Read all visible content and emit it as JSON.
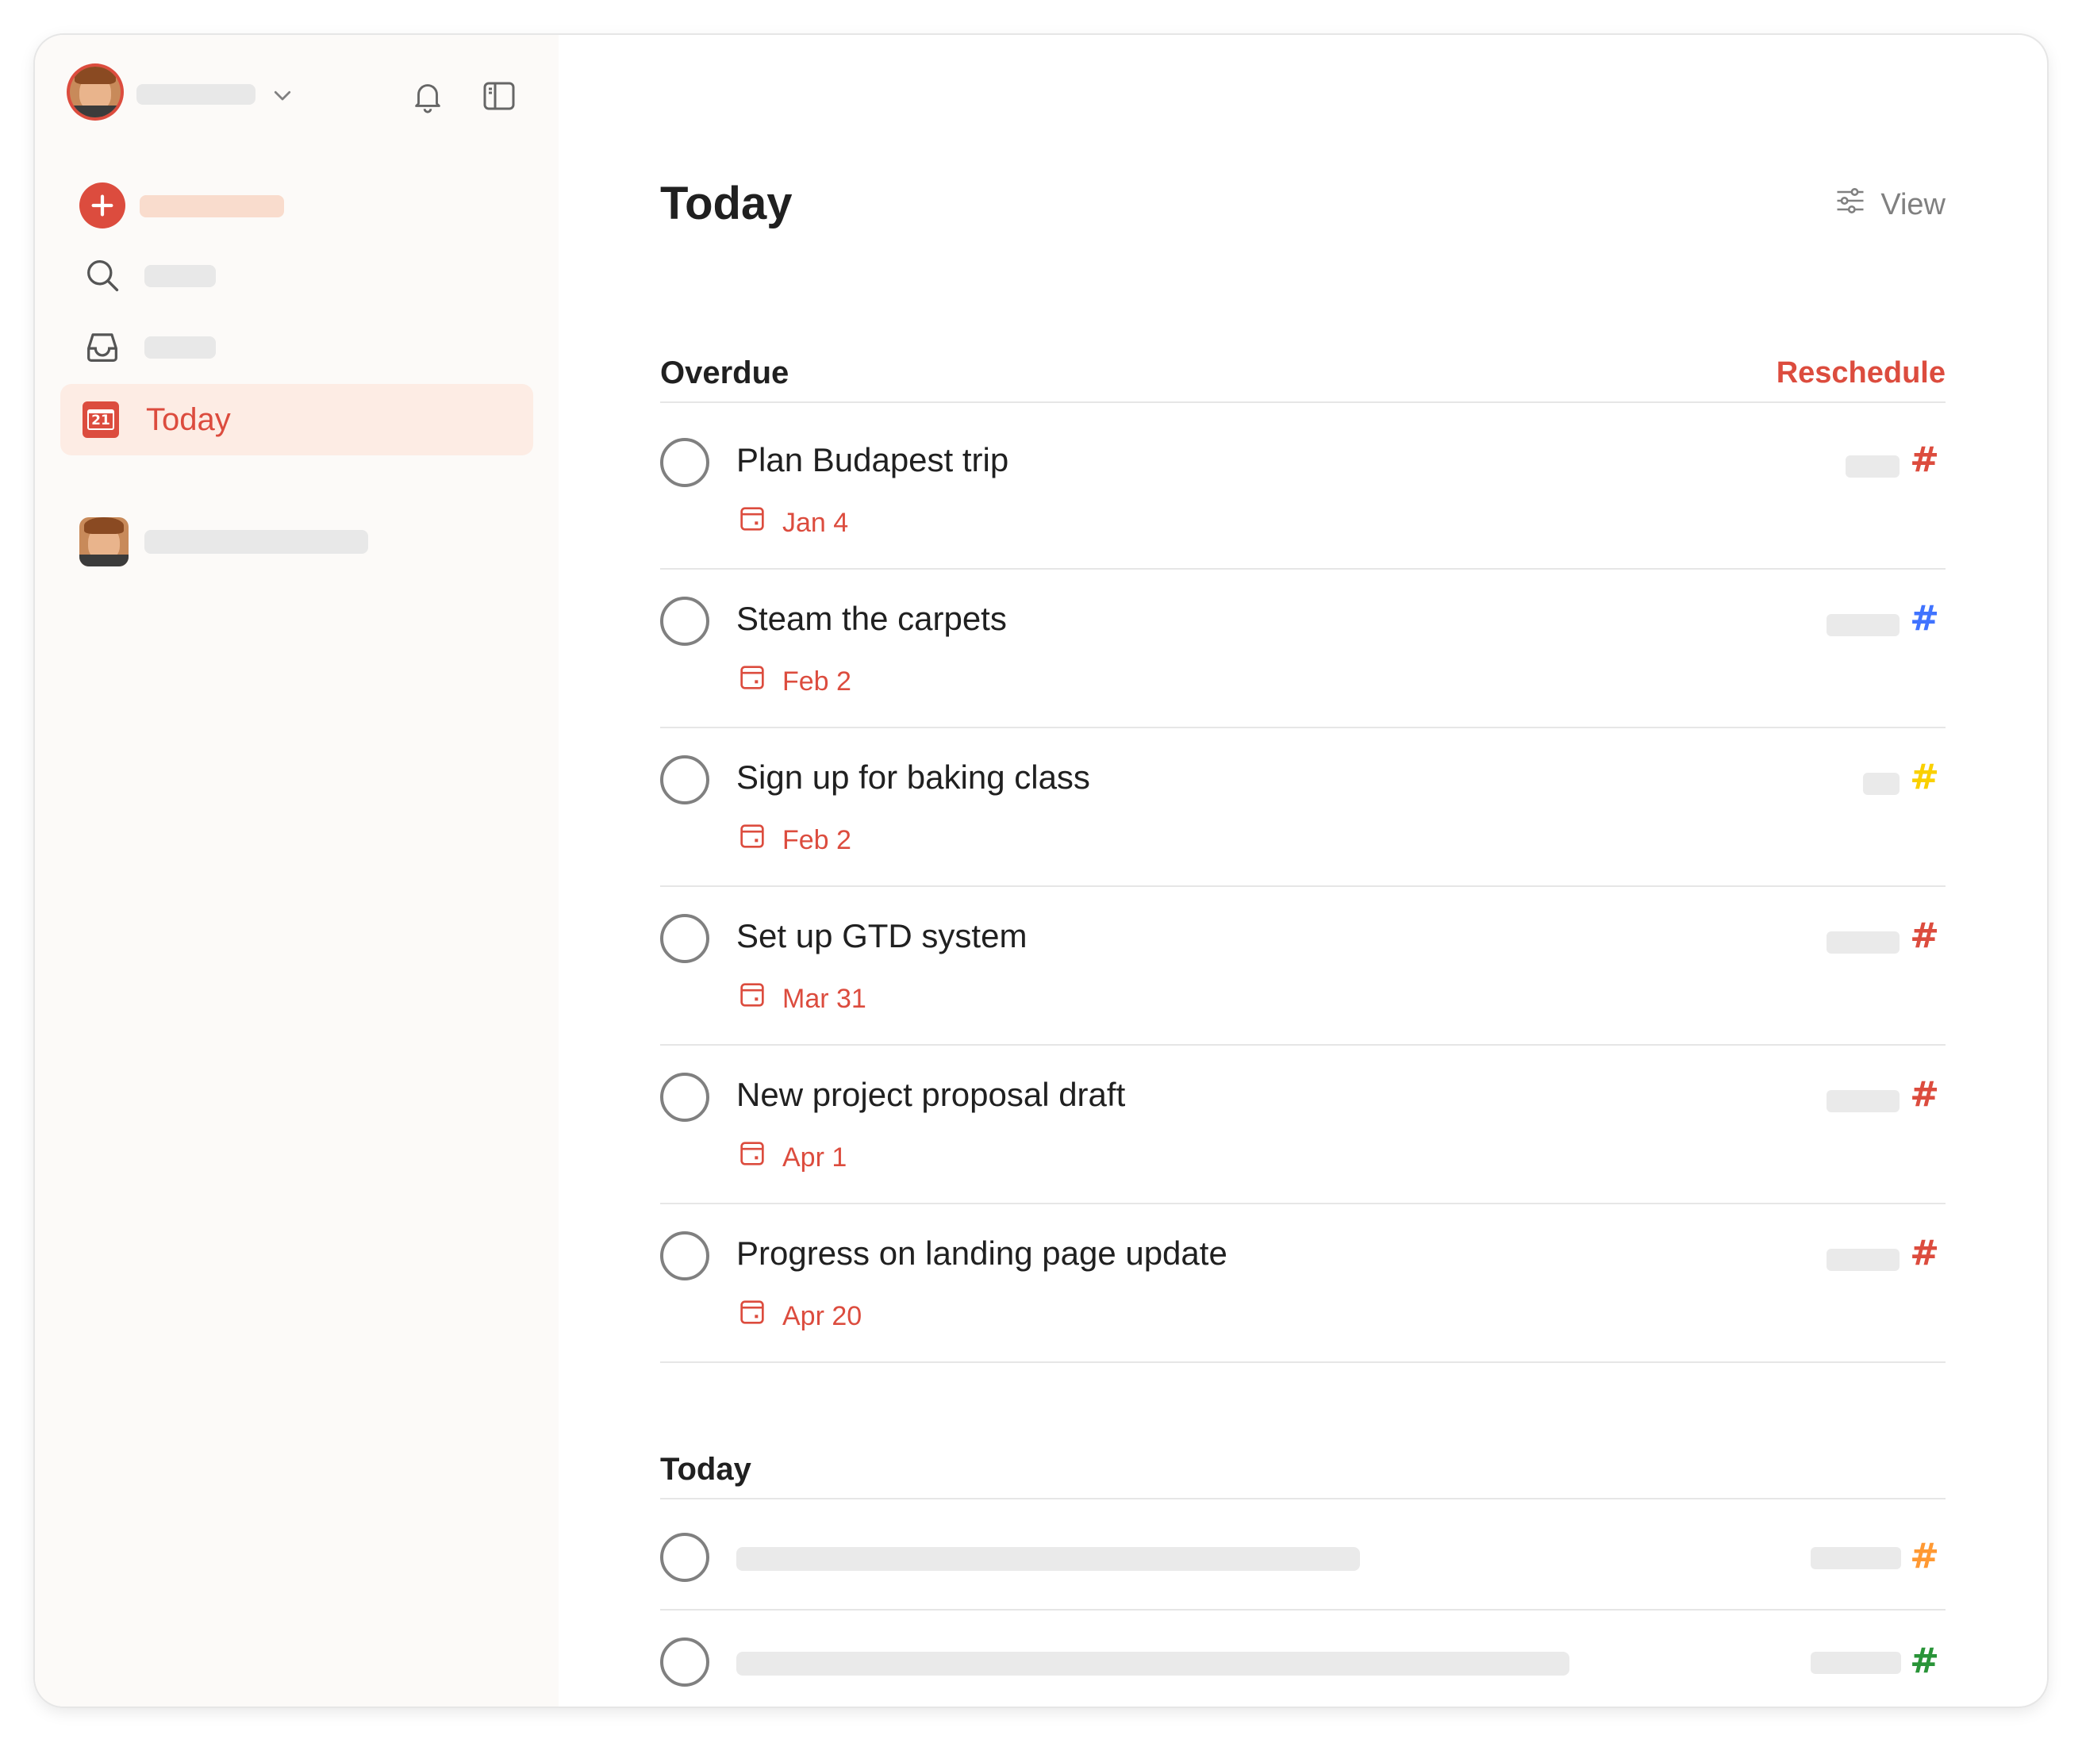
{
  "sidebar": {
    "today_label": "Today",
    "today_badge_number": "21",
    "icons": {
      "notifications": "bell-icon",
      "toggle_sidebar": "sidebar-toggle-icon",
      "add_task": "plus-icon",
      "search": "search-icon",
      "inbox": "inbox-icon",
      "today": "calendar-icon"
    }
  },
  "main": {
    "title": "Today",
    "view_label": "View",
    "overdue": {
      "title": "Overdue",
      "action": "Reschedule",
      "tasks": [
        {
          "content": "Plan Budapest trip",
          "due": "Jan 4",
          "project_color": "#dc4c3e"
        },
        {
          "content": "Steam the carpets",
          "due": "Feb 2",
          "project_color": "#4073ff"
        },
        {
          "content": "Sign up for baking class",
          "due": "Feb 2",
          "project_color": "#fad000"
        },
        {
          "content": "Set up GTD system",
          "due": "Mar 31",
          "project_color": "#dc4c3e"
        },
        {
          "content": "New project proposal draft",
          "due": "Apr 1",
          "project_color": "#dc4c3e"
        },
        {
          "content": "Progress on landing page update",
          "due": "Apr 20",
          "project_color": "#dc4c3e"
        }
      ]
    },
    "today_section": {
      "title": "Today",
      "tasks": [
        {
          "project_color": "#ff9933"
        },
        {
          "project_color": "#299438"
        }
      ]
    },
    "project_hash": "#"
  },
  "colors": {
    "accent": "#dc4c3e",
    "sidebar_bg": "#fcfaf8",
    "selected_bg": "#fdece4"
  }
}
